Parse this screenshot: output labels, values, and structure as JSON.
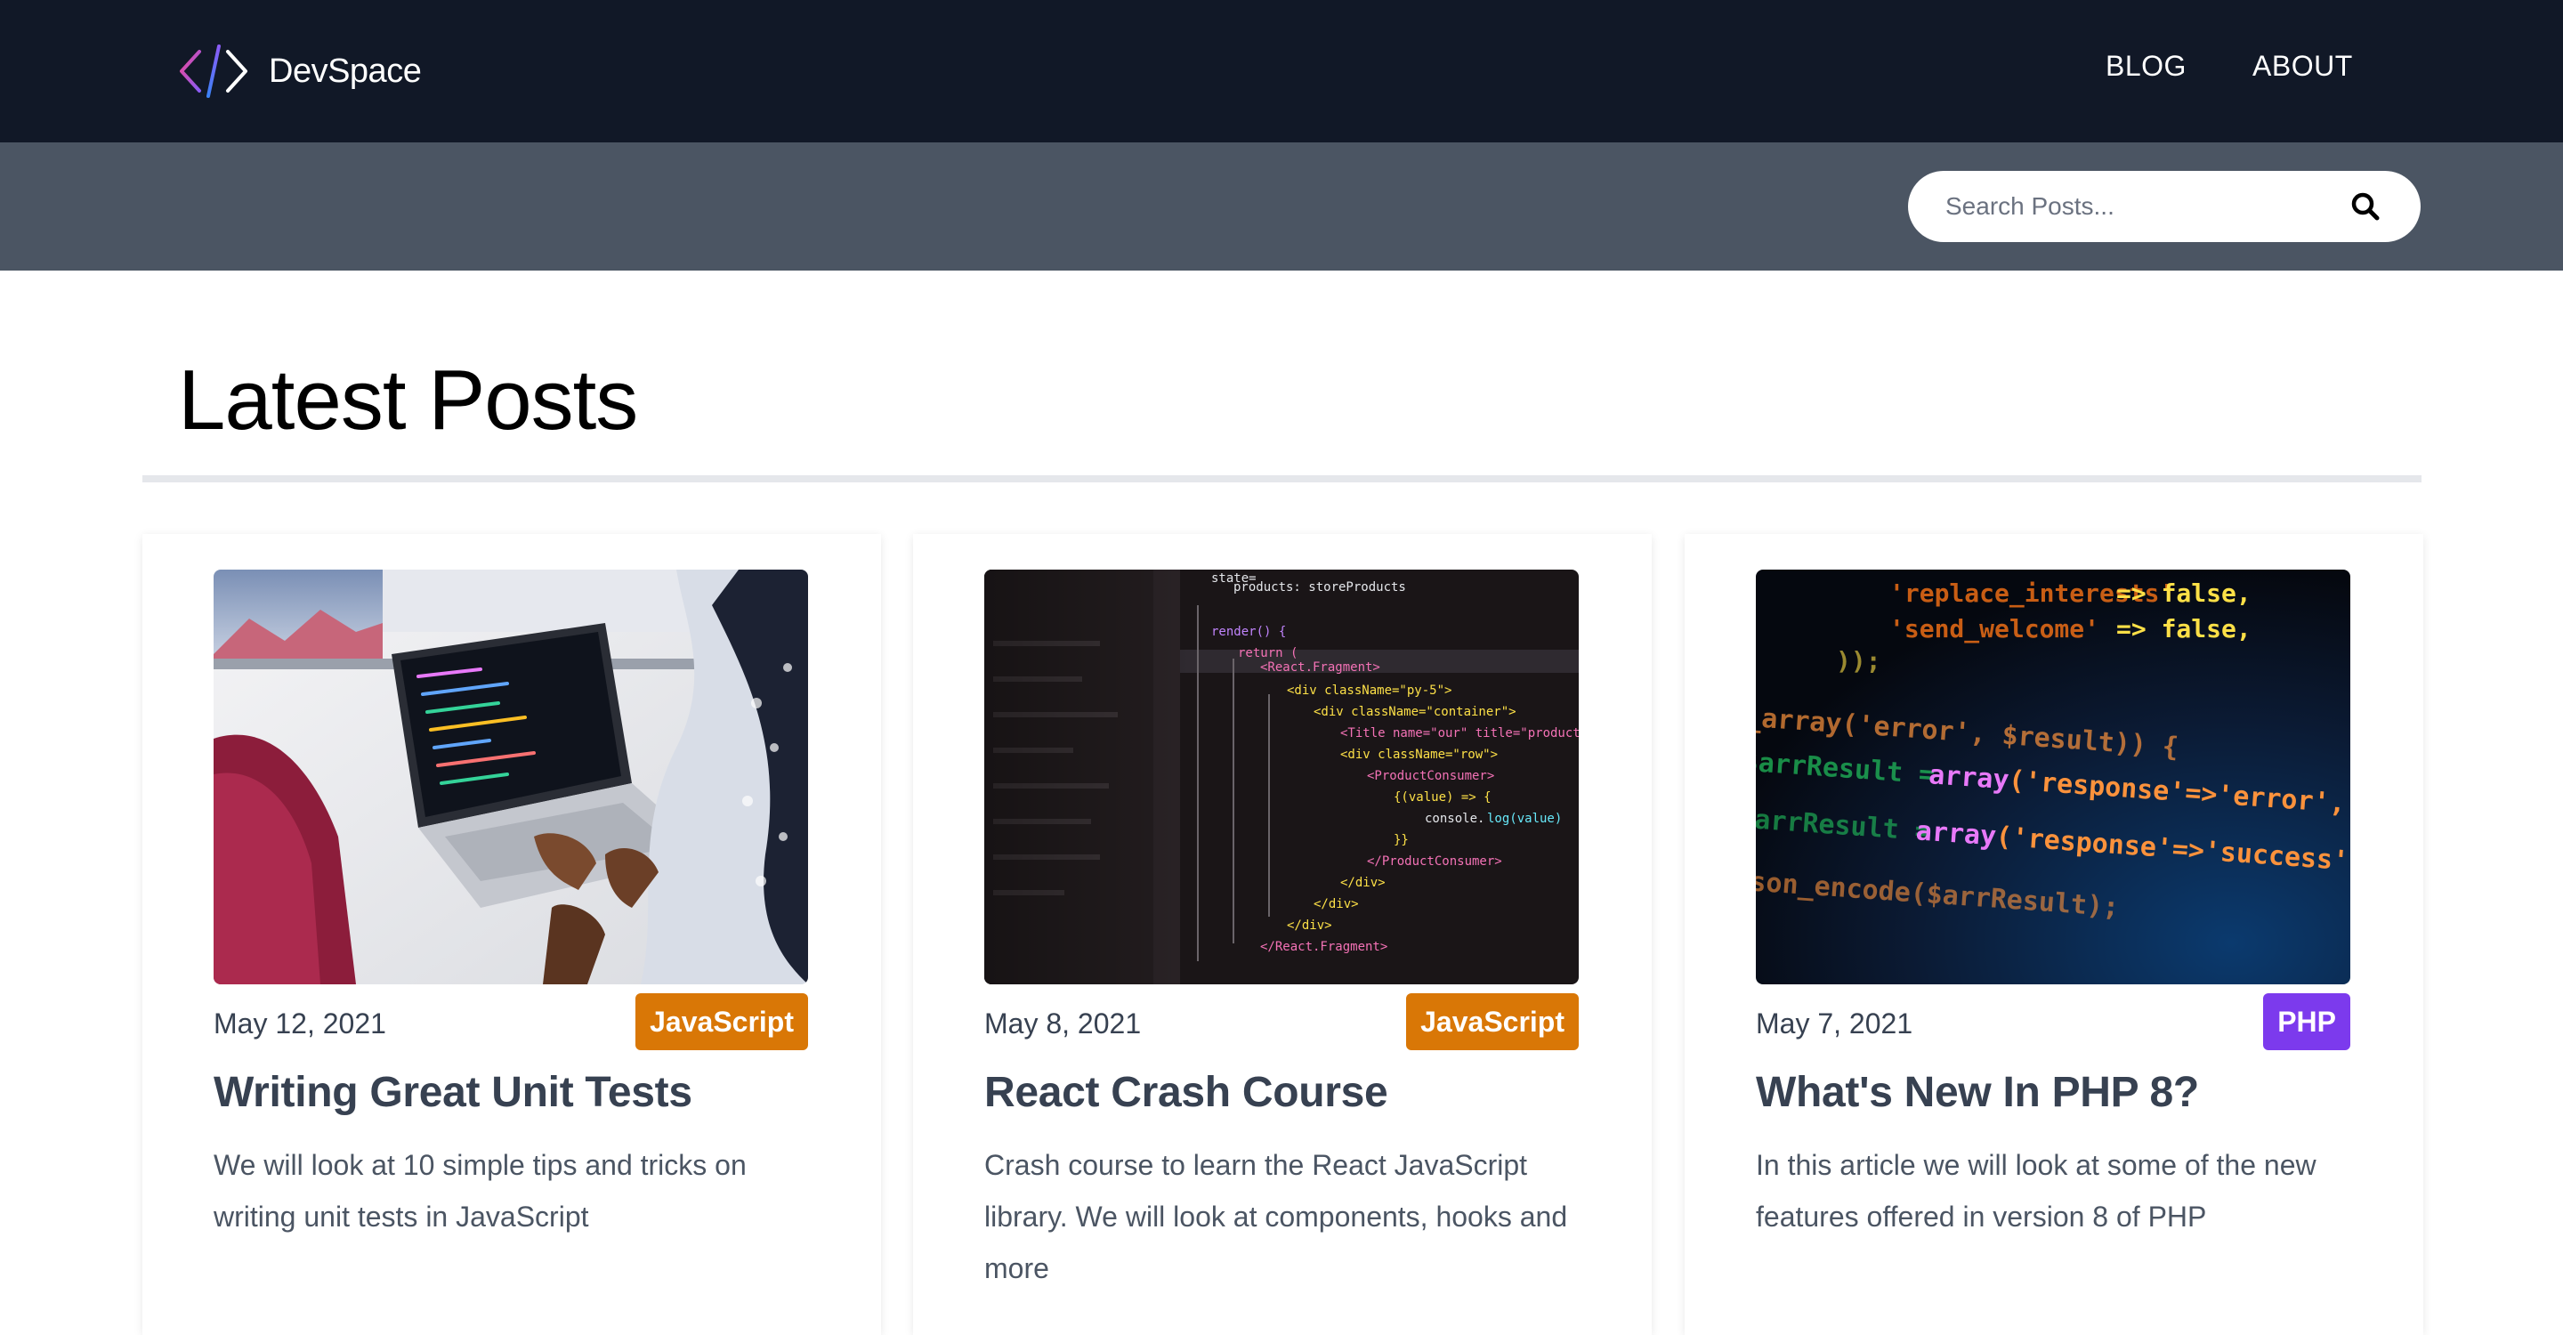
{
  "nav": {
    "brand": "DevSpace",
    "links": [
      {
        "label": "BLOG"
      },
      {
        "label": "ABOUT"
      }
    ]
  },
  "search": {
    "placeholder": "Search Posts...",
    "icon": "search-icon"
  },
  "main": {
    "title": "Latest Posts"
  },
  "posts": [
    {
      "date": "May 12, 2021",
      "category": "JavaScript",
      "category_color": "#d97706",
      "title": "Writing Great Unit Tests",
      "excerpt": "We will look at 10 simple tips and tricks on writing unit tests in JavaScript",
      "image": "laptop-coding-photo"
    },
    {
      "date": "May 8, 2021",
      "category": "JavaScript",
      "category_color": "#d97706",
      "title": "React Crash Course",
      "excerpt": "Crash course to learn the React JavaScript library. We will look at components, hooks and more",
      "image": "react-code-screen-photo"
    },
    {
      "date": "May 7, 2021",
      "category": "PHP",
      "category_color": "#7c3aed",
      "title": "What's New In PHP 8?",
      "excerpt": "In this article we will look at some of the new features offered in version 8 of PHP",
      "image": "php-code-screen-photo"
    }
  ],
  "colors": {
    "navbar": "#111827",
    "searchbar": "#4b5563",
    "text_dark": "#374151",
    "javascript": "#d97706",
    "php": "#7c3aed"
  }
}
